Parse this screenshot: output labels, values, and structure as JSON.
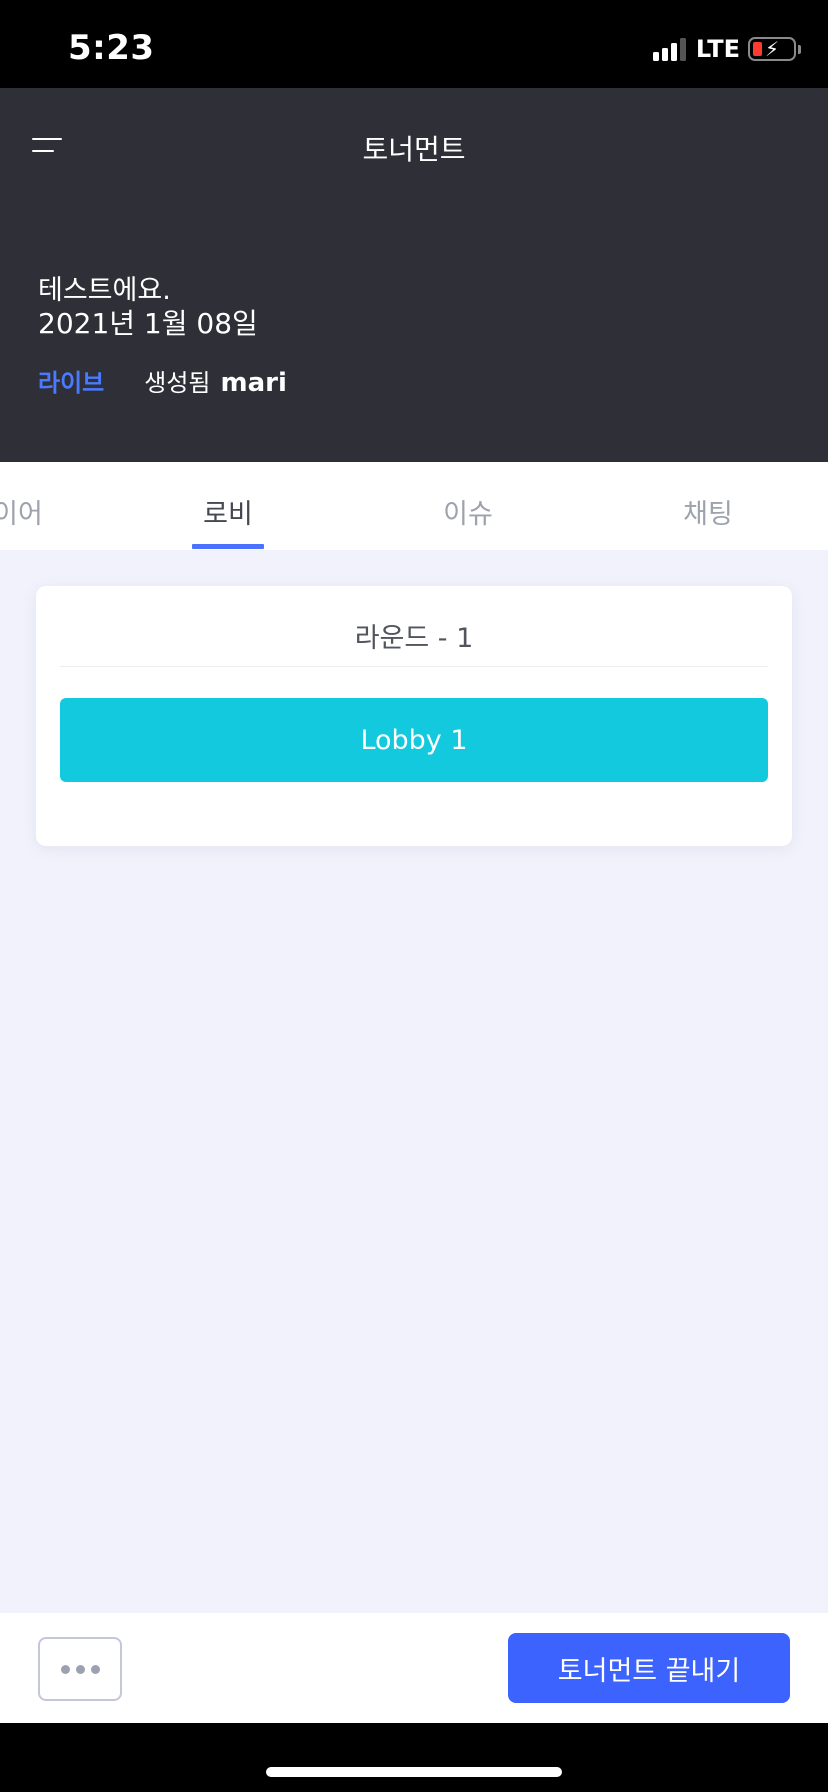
{
  "status_bar": {
    "time": "5:23",
    "network": "LTE",
    "icons": [
      "signal-icon",
      "battery-charging-icon"
    ]
  },
  "header": {
    "title": "토너먼트",
    "menu_icon": "hamburger-menu-icon",
    "tournament_name": "테스트에요.",
    "tournament_date": "2021년 1월 08일",
    "status_badge": "라이브",
    "created_label": "생성됨",
    "creator": "mari"
  },
  "tabs": {
    "items": [
      {
        "label": "이어",
        "active": false
      },
      {
        "label": "로비",
        "active": true
      },
      {
        "label": "이슈",
        "active": false
      },
      {
        "label": "채팅",
        "active": false
      }
    ],
    "active_color": "#4a72ff"
  },
  "round": {
    "title": "라운드 - 1",
    "lobbies": [
      {
        "label": "Lobby 1",
        "color": "#13c9dd"
      }
    ]
  },
  "bottom_bar": {
    "more_icon": "more-dots-icon",
    "end_button_label": "토너먼트 끝내기",
    "end_button_color": "#3d63ff"
  },
  "colors": {
    "header_bg": "#2f2f37",
    "content_bg": "#f1f2fb",
    "live": "#4a7aff"
  }
}
